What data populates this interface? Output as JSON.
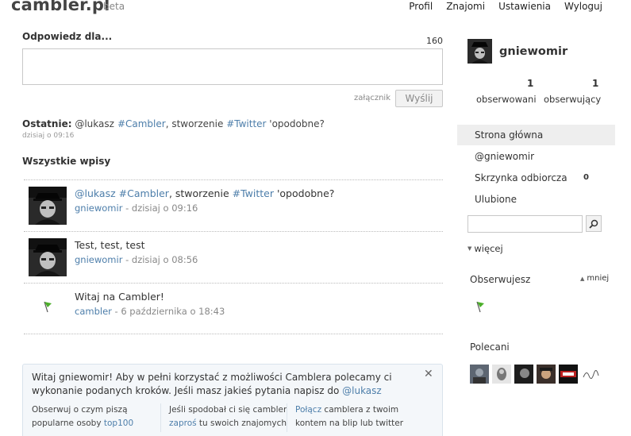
{
  "header": {
    "logo": "cambler.pl",
    "beta": "beta",
    "nav": [
      "Profil",
      "Znajomi",
      "Ustawienia",
      "Wyloguj"
    ]
  },
  "reply": {
    "title": "Odpowiedz dla...",
    "counter": "160",
    "value": "",
    "attachment_label": "załącznik",
    "send_label": "Wyślij"
  },
  "latest": {
    "label": "Ostatnie:",
    "mention": "@lukasz",
    "tag1": "#Cambler",
    "text1": ", stworzenie ",
    "tag2": "#Twitter",
    "text2": " 'opodobne?",
    "time": "dzisiaj o 09:16"
  },
  "all_posts_title": "Wszystkie wpisy",
  "posts": [
    {
      "mention": "@lukasz",
      "tag1": "#Cambler",
      "text1": ", stworzenie ",
      "tag2": "#Twitter",
      "text2": " 'opodobne?",
      "author": "gniewomir",
      "meta": " - dzisiaj o 09:16"
    },
    {
      "text": "Test, test, test",
      "author": "gniewomir",
      "meta": " - dzisiaj o 08:56"
    },
    {
      "text": "Witaj na Cambler!",
      "author": "cambler",
      "meta": " - 6 października o 18:43"
    }
  ],
  "notice": {
    "text": "Witaj gniewomir! Aby w pełni korzystać z możliwości Camblera polecamy ci wykonanie podanych kroków. Jeśli masz jakieś pytania napisz do ",
    "link": "@lukasz",
    "close": "✕",
    "col1_text": "Obserwuj o czym piszą popularne osoby ",
    "col1_link": "top100",
    "col2_text1": "Jeśli spodobał ci się cambler ",
    "col2_link": "zaproś",
    "col2_text2": " tu swoich znajomych",
    "col3_link": "Połącz",
    "col3_text": " camblera z twoim kontem na blip lub twitter"
  },
  "sidebar": {
    "username": "gniewomir",
    "following_count": "1",
    "following_label": "obserwowani",
    "followers_count": "1",
    "followers_label": "obserwujący",
    "menu": [
      {
        "label": "Strona główna",
        "badge": ""
      },
      {
        "label": "@gniewomir",
        "badge": ""
      },
      {
        "label": "Skrzynka odbiorcza",
        "badge": "0"
      },
      {
        "label": "Ulubione",
        "badge": ""
      }
    ],
    "search_value": "",
    "more_label": "więcej",
    "following_title": "Obserwujesz",
    "less_label": "mniej",
    "recommended_title": "Polecani",
    "accent": "#4d7eaa"
  }
}
